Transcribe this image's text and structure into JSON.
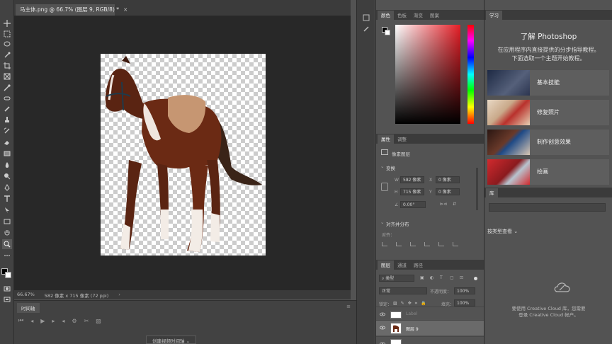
{
  "document": {
    "tab_title": "马主体.png @ 66.7% (图层 9, RGB/8) *",
    "zoom": "66.67%",
    "size_info": "582 像素 x 715 像素 (72 ppi)"
  },
  "timeline": {
    "tab_label": "时间轴",
    "create_button": "创建视频时间轴"
  },
  "color_panel": {
    "tabs": [
      "颜色",
      "色板",
      "渐变",
      "图案"
    ],
    "active_tab": 0,
    "foreground": "#000000",
    "background": "#ffffff",
    "picker_hue": "#e41e26"
  },
  "properties_panel": {
    "tabs": [
      "属性",
      "调整"
    ],
    "layer_type": "像素图层",
    "transform_label": "变换",
    "w_label": "W",
    "w_value": "582 像素",
    "h_label": "H",
    "h_value": "715 像素",
    "x_label": "X",
    "x_value": "0 像素",
    "y_label": "Y",
    "y_value": "0 像素",
    "angle": "0.00°",
    "align_label": "对齐并分布",
    "align_sub": "对齐："
  },
  "layers_panel": {
    "tabs": [
      "图层",
      "通道",
      "路径"
    ],
    "filter_kind": "类型",
    "blend_mode": "正常",
    "opacity_label": "不透明度：",
    "opacity_value": "100%",
    "lock_label": "锁定：",
    "fill_label": "填充：",
    "fill_value": "100%",
    "layers": [
      {
        "name": "Label",
        "visible": true
      },
      {
        "name": "图层 9",
        "visible": true,
        "selected": true
      },
      {
        "name": "",
        "visible": true
      }
    ]
  },
  "learn_panel": {
    "tab": "学习",
    "title": "了解 Photoshop",
    "subtitle_1": "在应用程序内直接提供的分步指导教程。",
    "subtitle_2": "下面选取一个主题开始教程。",
    "items": [
      {
        "label": "基本技能",
        "thumb_color": "#3b4660"
      },
      {
        "label": "修复照片",
        "thumb_color": "#c9a98a"
      },
      {
        "label": "制作创意效果",
        "thumb_color": "#4a2a22"
      },
      {
        "label": "绘画",
        "thumb_color": "#c7282e"
      }
    ]
  },
  "library_panel": {
    "tab": "库",
    "view_label": "按类型查看",
    "cc_text_1": "要使用 Creative Cloud 库，您需要",
    "cc_text_2": "登录 Creative Cloud 帐户。"
  }
}
